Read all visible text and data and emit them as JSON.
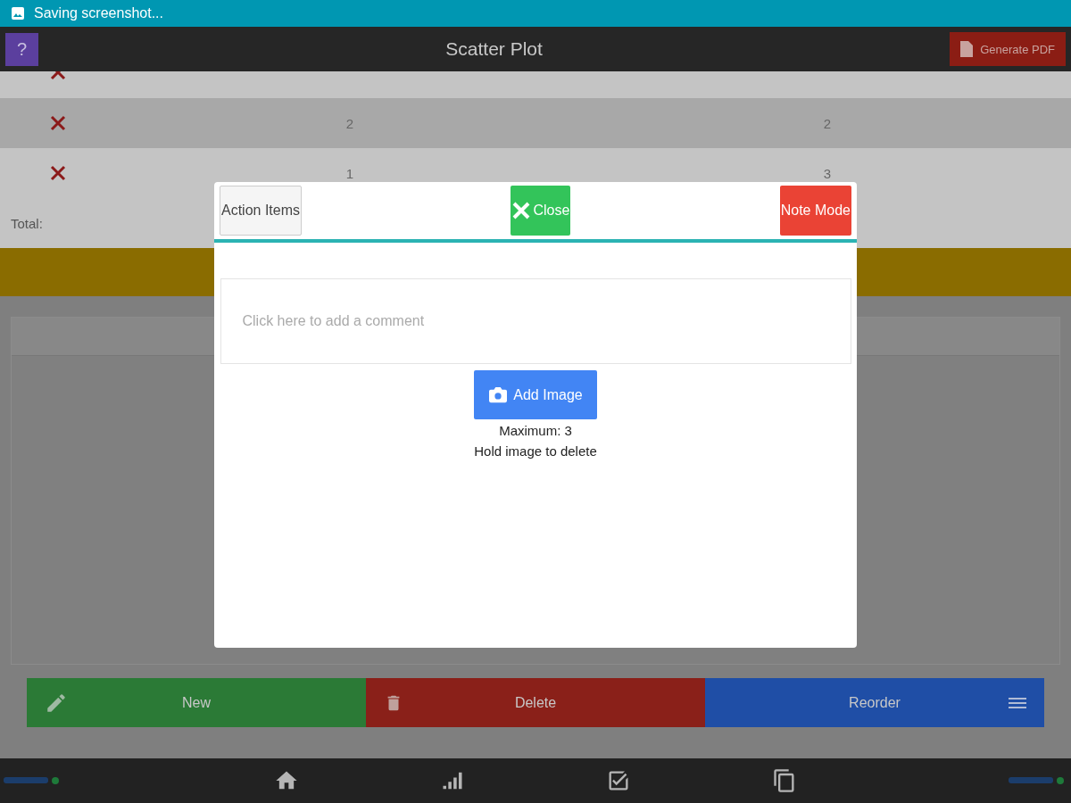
{
  "status_bar": {
    "text": "Saving screenshot..."
  },
  "app_bar": {
    "help": "?",
    "title": "Scatter Plot",
    "action": "Generate PDF"
  },
  "rows": [
    {
      "values": []
    },
    {
      "values": [
        "2",
        "2"
      ]
    },
    {
      "values": [
        "1",
        "3"
      ]
    }
  ],
  "total_label": "Total:",
  "actions": [
    {
      "kind": "new",
      "label": "New",
      "color": "#2b7a36"
    },
    {
      "kind": "delete",
      "label": "Delete",
      "color": "#8a2019"
    },
    {
      "kind": "reorder",
      "label": "Reorder",
      "color": "#1f4ea6"
    }
  ],
  "nav": [
    {
      "kind": "home"
    },
    {
      "kind": "chart"
    },
    {
      "kind": "check"
    },
    {
      "kind": "docs"
    }
  ],
  "modal": {
    "buttons": [
      {
        "kind": "plain",
        "label": "Action Items"
      },
      {
        "kind": "close",
        "label": "Close"
      },
      {
        "kind": "danger",
        "label": "Note Mode"
      }
    ],
    "comment_placeholder": "Click here to add a comment",
    "add_image": "Add Image",
    "notes": [
      "Maximum: 3",
      "Hold image to delete"
    ]
  }
}
